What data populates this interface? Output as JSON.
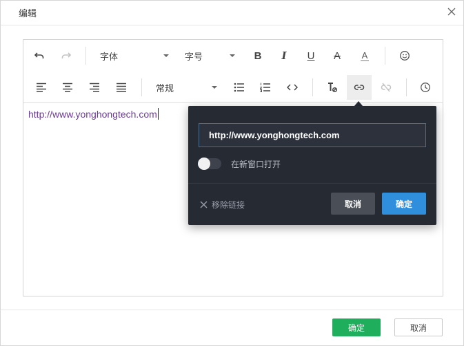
{
  "dialog": {
    "title": "编辑",
    "ok_label": "确定",
    "cancel_label": "取消"
  },
  "toolbar": {
    "font_family_label": "字体",
    "font_size_label": "字号",
    "paragraph_label": "常规",
    "bold_glyph": "B",
    "italic_glyph": "I",
    "underline_glyph": "U",
    "strike_glyph": "A",
    "font_color_glyph": "A",
    "code_glyph": "<>",
    "icons": [
      "undo-icon",
      "redo-icon",
      "bold-icon",
      "italic-icon",
      "underline-icon",
      "strikethrough-icon",
      "font-color-icon",
      "emoji-icon",
      "align-left-icon",
      "align-center-icon",
      "align-right-icon",
      "align-justify-icon",
      "bullet-list-icon",
      "numbered-list-icon",
      "code-icon",
      "clear-format-icon",
      "link-icon",
      "unlink-icon",
      "history-icon"
    ]
  },
  "content": {
    "text": "http://www.yonghongtech.com"
  },
  "link_popover": {
    "url_value": "http://www.yonghongtech.com",
    "open_new_window_label": "在新窗口打开",
    "open_new_window_on": false,
    "remove_link_label": "移除链接",
    "cancel_label": "取消",
    "ok_label": "确定"
  },
  "colors": {
    "primary_green": "#1fae5b",
    "popover_bg": "#262a33",
    "popover_ok": "#2f8fdc",
    "link_text": "#6a3d8f"
  }
}
